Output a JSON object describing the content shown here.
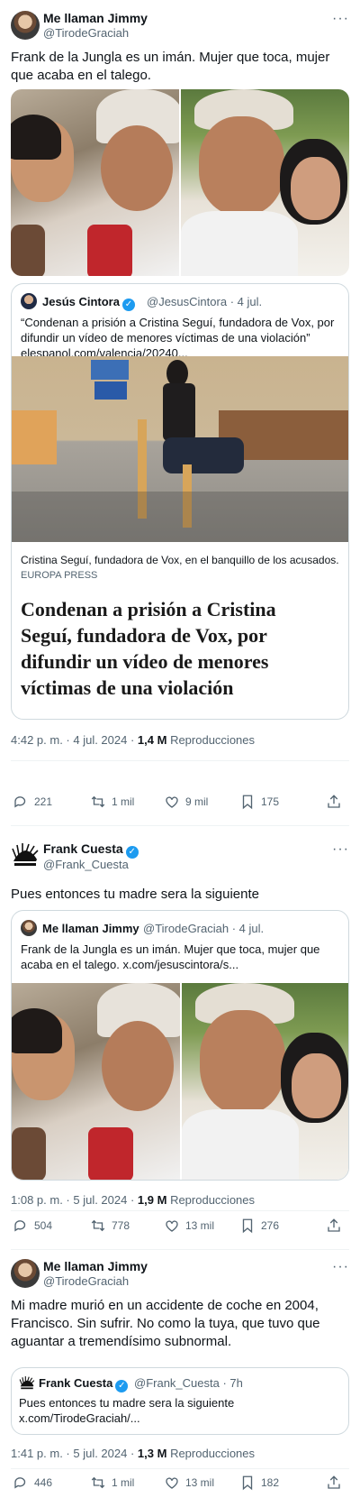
{
  "tweet1": {
    "name": "Me llaman Jimmy",
    "handle": "@TirodeGraciah",
    "text": "Frank de la Jungla es un imán. Mujer que toca, mujer que acaba en el talego.",
    "quote": {
      "name": "Jesús Cintora",
      "handle": "@JesusCintora",
      "time": "· 4 jul.",
      "text": "“Condenan a prisión a Cristina Seguí, fundadora de Vox, por difundir un vídeo de menores víctimas de una violación”",
      "link": "elespanol.com/valencia/20240...",
      "caption": "Cristina Seguí, fundadora de Vox, en el banquillo de los acusados.",
      "credit": "EUROPA PRESS",
      "headline": "Condenan a prisión a Cristina Seguí, fundadora de Vox, por difundir un vídeo de menores víctimas de una violación"
    },
    "timestamp": "4:42 p. m. · 4 jul. 2024 ·",
    "views": "1,4 M",
    "views_label": "Reproducciones",
    "replies": "221",
    "retweets": "1 mil",
    "likes": "9 mil",
    "bookmarks": "175"
  },
  "tweet2": {
    "name": "Frank Cuesta",
    "handle": "@Frank_Cuesta",
    "text": "Pues entonces tu madre sera la siguiente",
    "quote": {
      "name": "Me llaman Jimmy",
      "handle": "@TirodeGraciah",
      "time": "· 4 jul.",
      "text": "Frank de la Jungla es un imán. Mujer que toca, mujer que acaba en el talego.",
      "link": "x.com/jesuscintora/s..."
    },
    "timestamp": "1:08 p. m. · 5 jul. 2024 ·",
    "views": "1,9 M",
    "views_label": "Reproducciones",
    "replies": "504",
    "retweets": "778",
    "likes": "13 mil",
    "bookmarks": "276"
  },
  "tweet3": {
    "name": "Me llaman Jimmy",
    "handle": "@TirodeGraciah",
    "text": "Mi madre murió en un accidente de coche en 2004, Francisco. Sin sufrir. No como la tuya, que tuvo que aguantar a tremendísimo subnormal.",
    "quote": {
      "name": "Frank Cuesta",
      "handle": "@Frank_Cuesta",
      "time": "· 7h",
      "text": "Pues entonces tu madre sera la siguiente",
      "link": "x.com/TirodeGraciah/..."
    },
    "timestamp": "1:41 p. m. · 5 jul. 2024 ·",
    "views": "1,3 M",
    "views_label": "Reproducciones",
    "replies": "446",
    "retweets": "1 mil",
    "likes": "13 mil",
    "bookmarks": "182"
  },
  "colors": {
    "accent": "#1d9bf0",
    "secondary_text": "#536471",
    "border": "#cfd9de"
  },
  "icons": [
    "more-icon",
    "verified-icon",
    "reply-icon",
    "retweet-icon",
    "like-icon",
    "bookmark-icon",
    "share-icon"
  ]
}
